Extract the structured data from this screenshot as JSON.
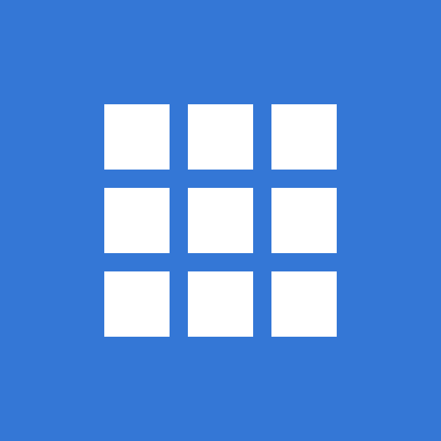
{
  "icon": {
    "name": "app-grid-icon",
    "rows": 3,
    "columns": 3
  },
  "colors": {
    "background": "#3477D6",
    "foreground": "#FFFFFF"
  }
}
